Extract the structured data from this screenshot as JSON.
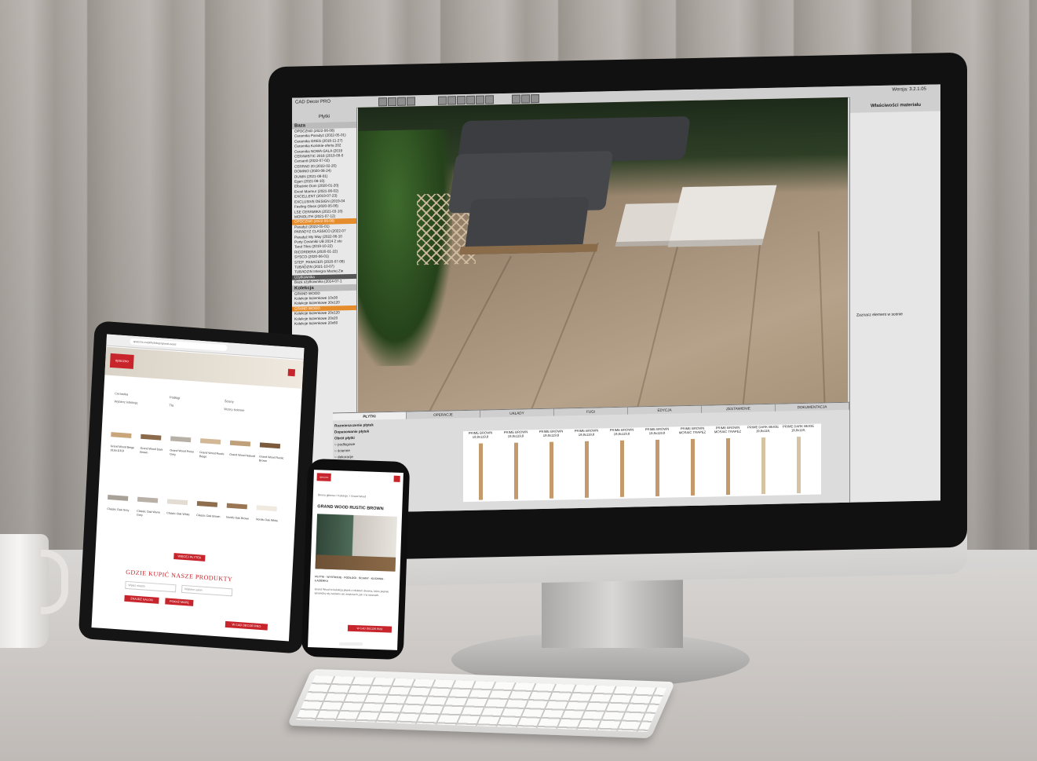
{
  "cad_app": {
    "title": "CAD Decor PRO",
    "version": "Wersja: 3.2.1.05",
    "left_panel": {
      "header": "Płytki",
      "list_title": "Baza",
      "items": [
        "OPOCZNO (2022-06-08)",
        "Ceramika Paradyż (2022-05-01)",
        "Ceramika GRES (2018-11-27)",
        "Ceramika Końskie-oferta 202",
        "Ceramika NOWA GALA (2019",
        "CERAMSTIC 2018 (2019-09-0",
        "Cersanit (2022-07-02)",
        "CERRAD 20 (2022-02-20)",
        "DOMINO (2020-08-24)",
        "DUNIN (2021-08-01)",
        "Egen (2021-08-10)",
        "Elbaśnie Dom (2020-01-20)",
        "Excel Marmur (2021-06-02)",
        "EXCELLENT (2019-07-23)",
        "EXCLUSIVE DESIGN (2019-04",
        "Feeling Glass (2020-05-06)",
        "LSE CERAMIKA (2021-03-10)",
        "MONOLITH (2021-07-12)",
        "OPOCZNO (2022-06-08)",
        "Paradyż (2022-05-01)",
        "PARADYŻ CLASSICO (2022-07",
        "Paradyż My Way (2022-06-10",
        "Porty Ceramiki UB 2014 2 sto",
        "Tarot Tiles (2019-10-22)",
        "RICORDERA (2020-01-22)",
        "SYSCO (2020-06-01)",
        "STEP_PASACER (2020-07-08)",
        "TUBADZIN (2021-10-07)",
        "TUBADZIN Intergra Maciej Zie"
      ],
      "selected_index": 18,
      "section2": "Użytkownika",
      "section2_item": "Baza użytkownika (2014-07-1",
      "collections_title": "Kolekcja",
      "collections": [
        "GRAND WOOD",
        "Kolekcje łazienkowe 10x30",
        "Kolekcje łazienkowe 30x120",
        "GRAND WOOD",
        "Kolekcje łazienkowe 20x120",
        "Kolekcje łazienkowe 20x20",
        "Kolekcje łazienkowe 20x60"
      ]
    },
    "right_panel": {
      "title": "Właściwości materiału",
      "hint": "Zaznacz element w scenie"
    },
    "bottom_panel": {
      "tabs": [
        "PŁYTKI",
        "OPERACJE",
        "UKŁADY",
        "FUGI",
        "EDYCJA",
        "ZESTAWIENIE",
        "DOKUMENTACJA"
      ],
      "active_tab": "PŁYTKI",
      "sub_tabs": [
        "Rozmieszczenie płytek",
        "Dopasowanie płytek",
        "Obrót płytki"
      ],
      "options": [
        "podłogowe",
        "ścienne",
        "dekoracje",
        "na całym obszarze",
        "w rzędzie",
        "w pasach",
        "pojedynczo",
        "w pionie"
      ],
      "tiles": [
        "PRIME BROWN 19,8x119,8",
        "PRIME BROWN 19,8x119,8",
        "PRIME BROWN 19,8x119,8",
        "PRIME BROWN 19,8x119,8",
        "PRIME BROWN 19,8x119,8",
        "PRIME BROWN 19,8x119,8",
        "PRIME BROWN MOSAIC TRAPEZ",
        "PRIME BROWN MOSAIC TRAPEZ",
        "PRIME DARK BEIGE 19,8x119,",
        "PRIME DARK BEIGE 19,8x119,"
      ]
    }
  },
  "tablet_site": {
    "url": "opoczno.eu/pl/kolekcje/grand-wood",
    "brand": "opoczno",
    "categories": [
      "Ceramika",
      "Podłogi",
      "Ściany",
      "Wybierz kolekcję",
      "Tła",
      "Wzory ścienne"
    ],
    "products": [
      "Grand Wood Beige 19,8x119,8",
      "Grand Wood Dark Brown",
      "Grand Wood Prime Grey",
      "Grand Wood Rustic Beige",
      "Grand Wood Natural",
      "Grand Wood Rustic Brown",
      "Classic Oak Grey",
      "Classic Oak Warm Grey",
      "Classic Oak White",
      "Classic Oak Brown",
      "Nordic Oak Brown",
      "Nordic Oak White"
    ],
    "load_more": "WIĘCEJ PŁYTEK",
    "heading": "GDZIE KUPIĆ NASZE PRODUKTY",
    "input_placeholder_1": "Wpisz miasto",
    "input_placeholder_2": "Wybierz salon",
    "button_1": "ZNAJDŹ SALON",
    "button_2": "POKAŻ MAPĘ",
    "cta": "W CAD DECOR PRO"
  },
  "phone_site": {
    "brand": "opoczno",
    "breadcrumb": "Strona główna > Kolekcje > Grand Wood",
    "title": "GRAND WOOD RUSTIC BROWN",
    "caption": "PŁYTKI · WYSTROJE · PODŁOGI · ŚCIANY · KUCHNIA · ŁAZIENKA",
    "body": "Grand Wood to kolekcja płytek z efektem drewna, które pięknie sprawdzą się zarówno we wnętrzach, jak i na tarasach.",
    "button": "W CAD DECOR PRO"
  }
}
